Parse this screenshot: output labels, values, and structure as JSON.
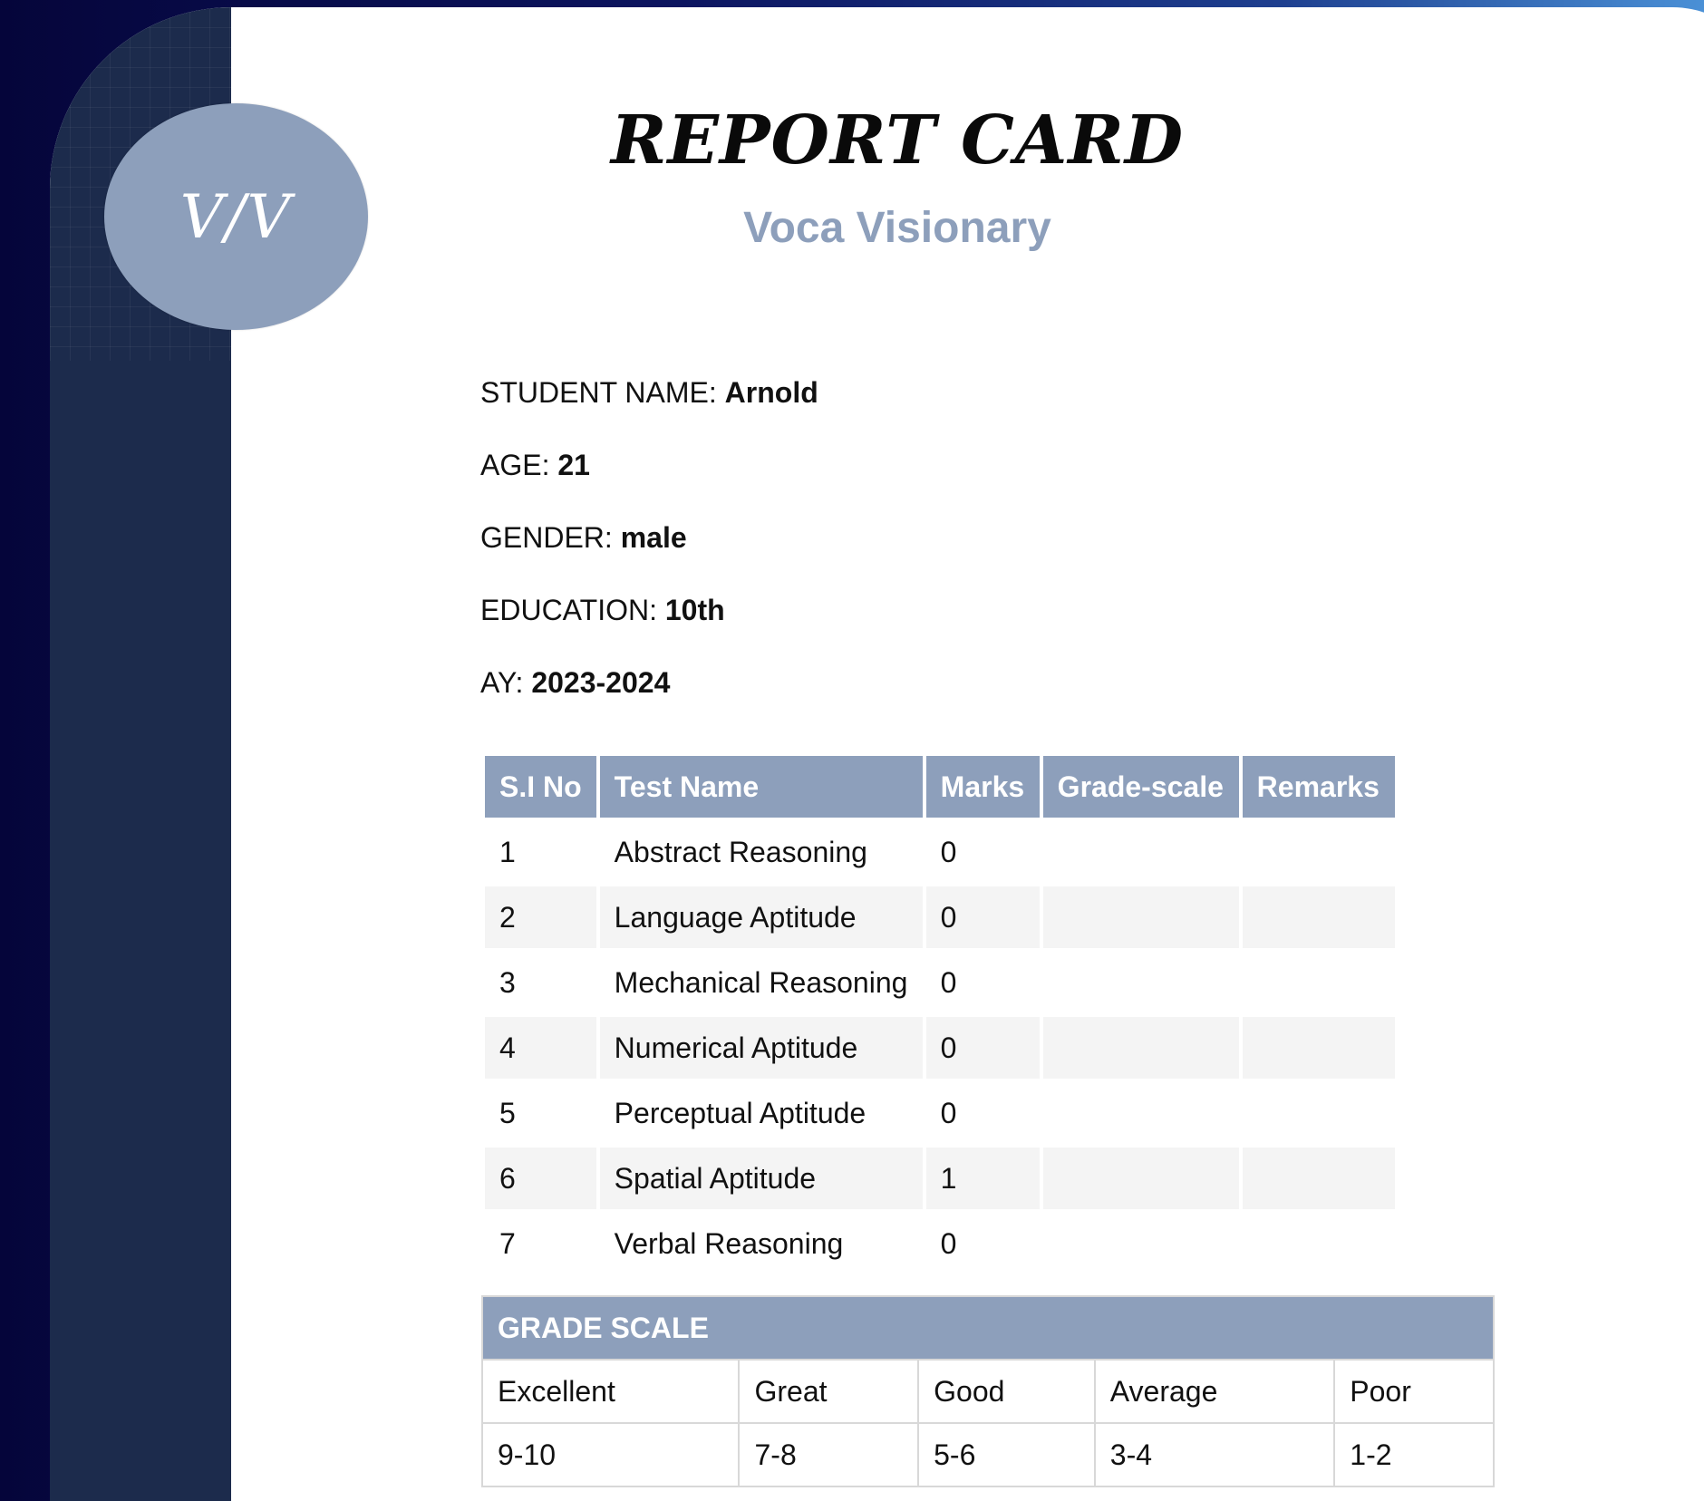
{
  "logo": {
    "text": "V/V"
  },
  "header": {
    "title": "REPORT CARD",
    "subtitle": "Voca Visionary"
  },
  "student": {
    "name_label": "STUDENT NAME:",
    "name": "Arnold",
    "age_label": "AGE:",
    "age": "21",
    "gender_label": "GENDER:",
    "gender": "male",
    "education_label": "EDUCATION:",
    "education": "10th",
    "ay_label": "AY:",
    "ay": "2023-2024"
  },
  "marks_table": {
    "headers": [
      "S.I No",
      "Test Name",
      "Marks",
      "Grade-scale",
      "Remarks"
    ],
    "rows": [
      {
        "sl": "1",
        "test": "Abstract Reasoning",
        "marks": "0",
        "grade": "",
        "remarks": ""
      },
      {
        "sl": "2",
        "test": "Language Aptitude",
        "marks": "0",
        "grade": "",
        "remarks": ""
      },
      {
        "sl": "3",
        "test": "Mechanical Reasoning",
        "marks": "0",
        "grade": "",
        "remarks": ""
      },
      {
        "sl": "4",
        "test": "Numerical Aptitude",
        "marks": "0",
        "grade": "",
        "remarks": ""
      },
      {
        "sl": "5",
        "test": "Perceptual Aptitude",
        "marks": "0",
        "grade": "",
        "remarks": ""
      },
      {
        "sl": "6",
        "test": "Spatial Aptitude",
        "marks": "1",
        "grade": "",
        "remarks": ""
      },
      {
        "sl": "7",
        "test": "Verbal Reasoning",
        "marks": "0",
        "grade": "",
        "remarks": ""
      }
    ]
  },
  "grade_scale": {
    "title": "GRADE SCALE",
    "levels": [
      "Excellent",
      "Great",
      "Good",
      "Average",
      "Poor"
    ],
    "ranges": [
      "9-10",
      "7-8",
      "5-6",
      "3-4",
      "1-2"
    ]
  },
  "colors": {
    "accent": "#8d9fbb",
    "sidebar": "#1c2b4c",
    "row_alt": "#f4f4f4"
  }
}
